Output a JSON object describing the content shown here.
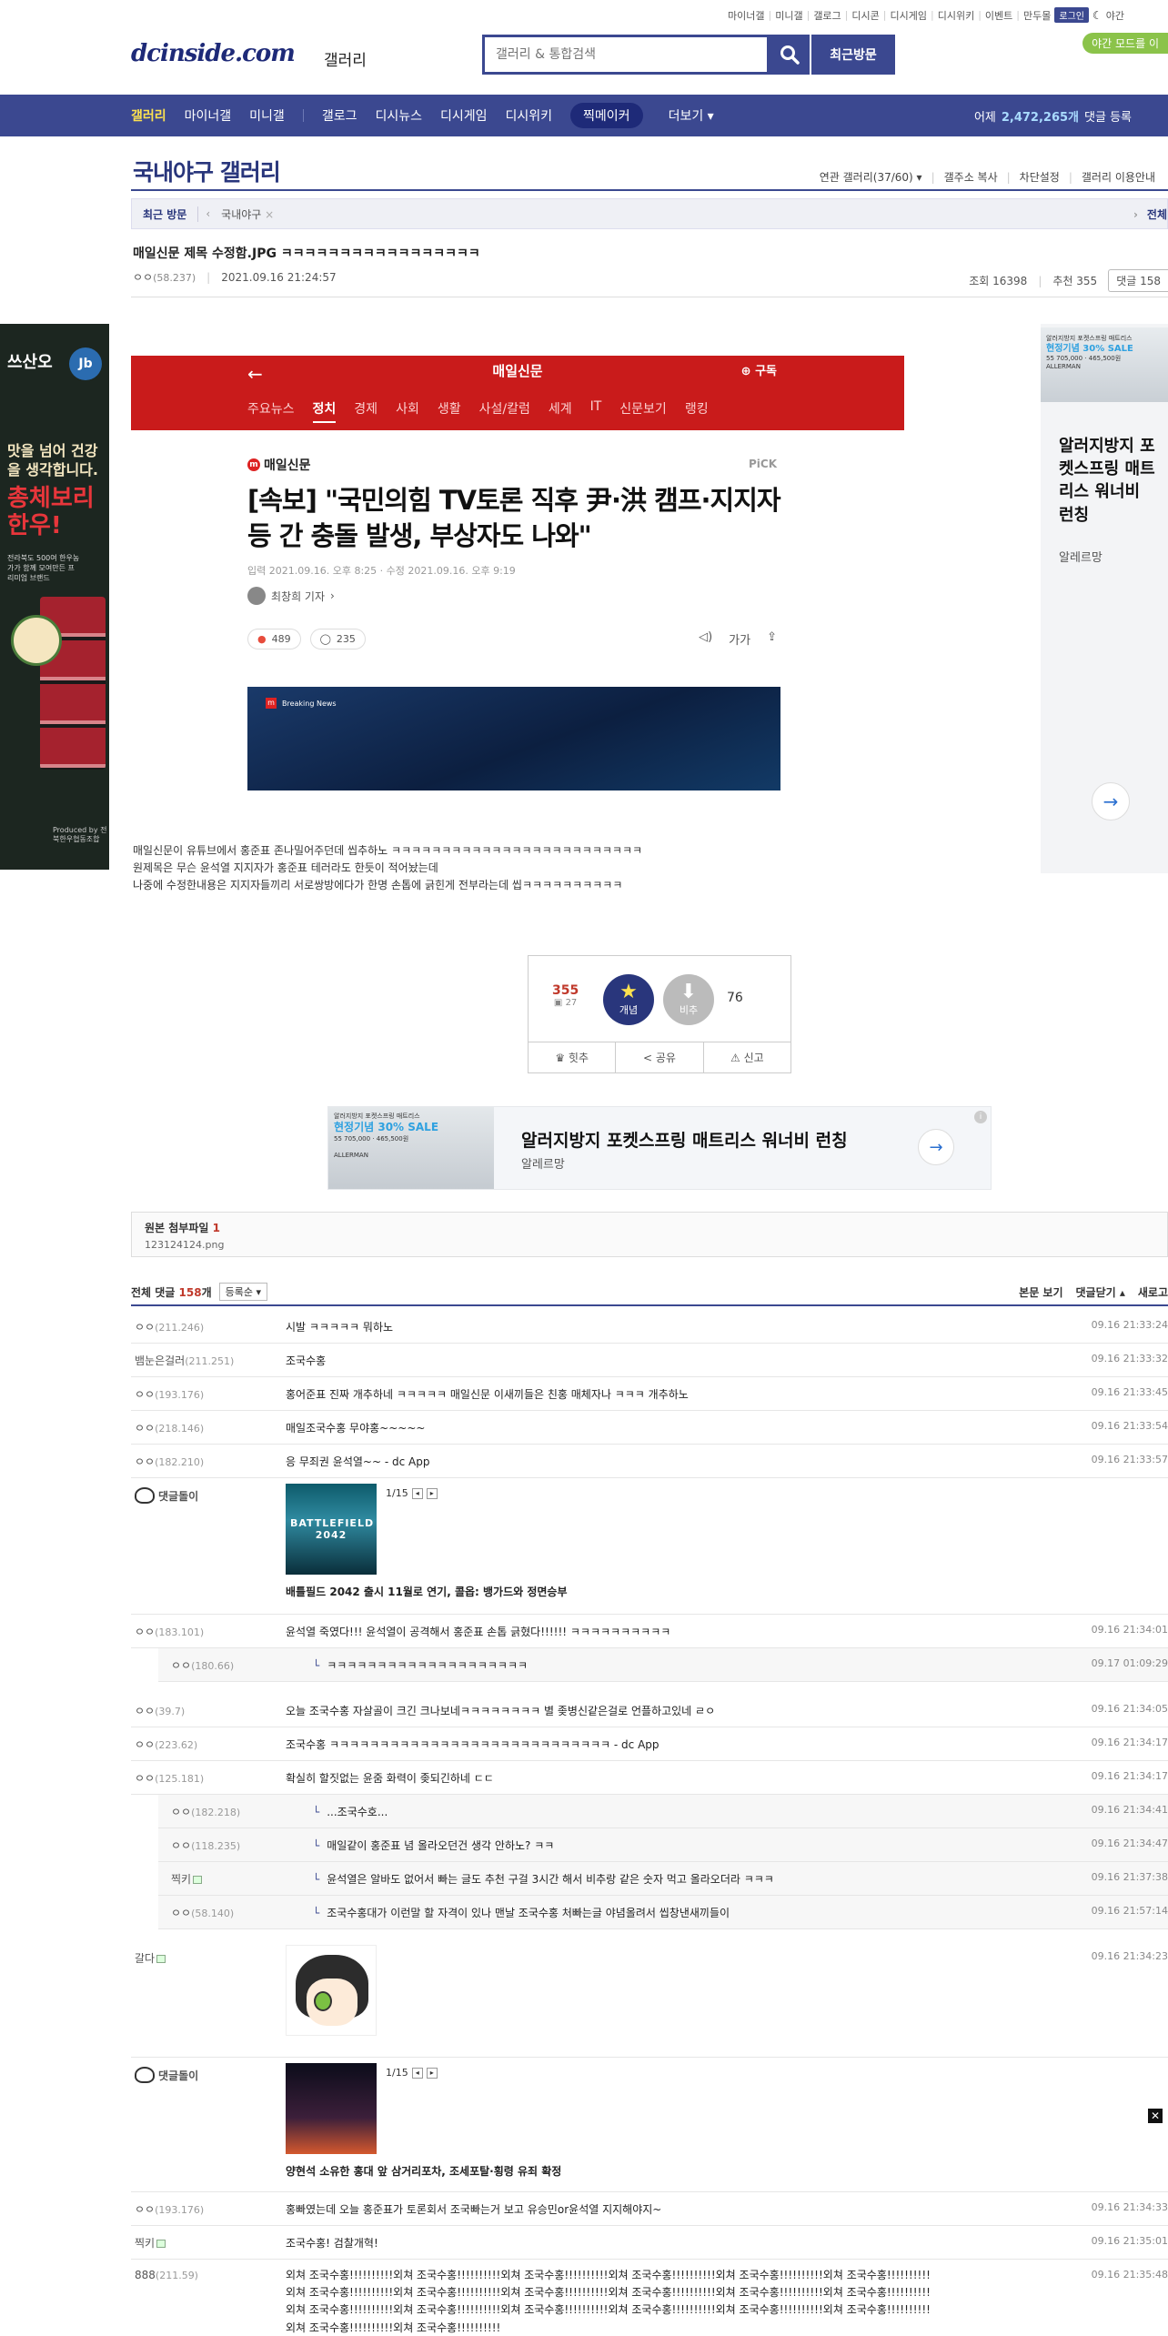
{
  "top_links": [
    "마이너갤",
    "미니갤",
    "갤로그",
    "디시콘",
    "디시게임",
    "디시위키",
    "이벤트",
    "만두몰"
  ],
  "login_label": "로그인",
  "night_short": "야간",
  "night_mode_btn": "야간 모드를 이",
  "logo": "dcinside.com",
  "logo_sub": "갤러리",
  "search": {
    "placeholder": "갤러리 & 통합검색"
  },
  "recent_visit_btn": "최근방문",
  "nav": {
    "items": [
      "갤러리",
      "마이너갤",
      "미니갤",
      "갤로그",
      "디시뉴스",
      "디시게임",
      "디시위키",
      "찍메이커",
      "더보기"
    ],
    "stats_prefix": "어제",
    "stats_num": "2,472,265개",
    "stats_suffix": "댓글 등록"
  },
  "gallery": {
    "title": "국내야구 갤러리",
    "links": [
      "연관 갤러리(37/60)",
      "갤주소 복사",
      "차단설정",
      "갤러리 이용안내"
    ],
    "recent_label": "최근 방문",
    "recent_tag": "국내야구",
    "recent_more": "전체"
  },
  "post": {
    "title": "매일신문 제목 수정함.JPG ㅋㅋㅋㅋㅋㅋㅋㅋㅋㅋㅋㅋㅋㅋㅋㅋㅋ",
    "author": "ㅇㅇ",
    "author_ip": "(58.237)",
    "date": "2021.09.16 21:24:57",
    "views": "조회 16398",
    "recommends": "추천 355",
    "comments": "댓글 158",
    "body": [
      "매일신문이 유튜브에서 홍준표 존나밀어주던데 씹추하노 ㅋㅋㅋㅋㅋㅋㅋㅋㅋㅋㅋㅋㅋㅋㅋㅋㅋㅋㅋㅋㅋㅋㅋㅋㅋ",
      "원제목은 무슨 윤석열 지지자가 홍준표 테러라도 한듯이 적어놨는데",
      "나중에 수정한내용은 지지자들끼리 서로쌍방에다가 한명 손톱에 긁힌게 전부라는데 씹ㅋㅋㅋㅋㅋㅋㅋㅋㅋㅋ"
    ]
  },
  "news": {
    "press_name": "매일신문",
    "subscribe": "구독",
    "tabs": [
      "주요뉴스",
      "정치",
      "경제",
      "사회",
      "생활",
      "사설/칼럼",
      "세계",
      "IT",
      "신문보기",
      "랭킹"
    ],
    "pick": "PiCK",
    "headline": "[속보] \"국민의힘 TV토론 직후 尹·洪 캠프·지지자 등 간 충돌 발생, 부상자도 나와\"",
    "date": "입력 2021.09.16. 오후 8:25 · 수정 2021.09.16. 오후 9:19",
    "reporter": "최창희 기자",
    "reactions": "489",
    "comment_count": "235",
    "font_btn": "가가",
    "image_label": "Breaking News"
  },
  "left_ad": {
    "brand": "쓰산오",
    "badge": "Jb",
    "tagline": "맛을 넘어 건강을 생각합니다.",
    "product": "총체보리 한우!",
    "desc": "전라북도 500여 한우농가가 함께 모여만든 프리미엄 브랜드",
    "producer": "Produced by 전북한우협동조합"
  },
  "right_ad": {
    "small": "알러지방지 포켓스프링 매트리스",
    "sale": "현정기념 30% SALE",
    "price": "55 705,000 · 465,500원",
    "brand_mark": "ALLERMAN",
    "title": "알러지방지 포켓스프링 매트리스 워너비 런칭",
    "by": "알레르망"
  },
  "recommend": {
    "up": "355",
    "fixed": "27",
    "up_label": "개념",
    "down_label": "비추",
    "down": "76",
    "hit": "힛추",
    "share": "공유",
    "report": "신고"
  },
  "mid_ad": {
    "title": "알러지방지 포켓스프링 매트리스 워너비 런칭",
    "by": "알레르망"
  },
  "attach": {
    "label": "원본 첨부파일",
    "count": "1",
    "file": "123124124.png"
  },
  "comment_head": {
    "label": "전체 댓글",
    "count": "158",
    "unit": "개",
    "sort": "등록순",
    "view_body": "본문 보기",
    "close": "댓글닫기",
    "refresh": "새로고"
  },
  "comments": [
    {
      "nick": "ㅇㅇ",
      "ip": "(211.246)",
      "text": "시발 ㅋㅋㅋㅋㅋ 뭐하노",
      "time": "09.16 21:33:24"
    },
    {
      "nick": "뱀눈은걸러",
      "ip": "(211.251)",
      "text": "조국수홍",
      "time": "09.16 21:33:32"
    },
    {
      "nick": "ㅇㅇ",
      "ip": "(193.176)",
      "text": "홍어준표 진짜 개추하네 ㅋㅋㅋㅋㅋ 매일신문 이새끼들은 친홍 매체자나 ㅋㅋㅋ 개추하노",
      "time": "09.16 21:33:45"
    },
    {
      "nick": "ㅇㅇ",
      "ip": "(218.146)",
      "text": "매일조국수홍 무야홍~~~~~",
      "time": "09.16 21:33:54"
    },
    {
      "nick": "ㅇㅇ",
      "ip": "(182.210)",
      "text": "응 무죄권 윤석열~~ - dc App",
      "time": "09.16 21:33:57"
    },
    {
      "nick": "댓글돌이",
      "text": "",
      "page": "1/15",
      "caption": "배틀필드 2042 출시 11월로 연기, 콜옵: 뱅가드와 정면승부",
      "thumb": "BATTLEFIELD 2042"
    },
    {
      "nick": "ㅇㅇ",
      "ip": "(183.101)",
      "text": "윤석열 죽였다!!! 윤석열이 공격해서 홍준표 손톱 긁혔다!!!!!! ㅋㅋㅋㅋㅋㅋㅋㅋㅋㅋ",
      "time": "09.16 21:34:01"
    },
    {
      "nick": "ㅇㅇ",
      "ip": "(180.66)",
      "text": "ㅋㅋㅋㅋㅋㅋㅋㅋㅋㅋㅋㅋㅋㅋㅋㅋㅋㅋㅋㅋ",
      "time": "09.17 01:09:29"
    },
    {
      "nick": "ㅇㅇ",
      "ip": "(39.7)",
      "text": "오늘 조국수홍 자살골이 크긴 크나보네ㅋㅋㅋㅋㅋㅋㅋㅋ 별 좆병신같은걸로 언플하고있네 ㄹㅇ",
      "time": "09.16 21:34:05"
    },
    {
      "nick": "ㅇㅇ",
      "ip": "(223.62)",
      "text": "조국수홍 ㅋㅋㅋㅋㅋㅋㅋㅋㅋㅋㅋㅋㅋㅋㅋㅋㅋㅋㅋㅋㅋㅋㅋㅋㅋㅋㅋㅋ - dc App",
      "time": "09.16 21:34:17"
    },
    {
      "nick": "ㅇㅇ",
      "ip": "(125.181)",
      "text": "확실히 할짓없는 윤줌 화력이 좆되긴하네 ㄷㄷ",
      "time": "09.16 21:34:17"
    },
    {
      "nick": "ㅇㅇ",
      "ip": "(182.218)",
      "text": "...조국수호...",
      "time": "09.16 21:34:41"
    },
    {
      "nick": "ㅇㅇ",
      "ip": "(118.235)",
      "text": "매일같이 홍준표 념 올라오던건 생각 안하노? ㅋㅋ",
      "time": "09.16 21:34:47"
    },
    {
      "nick": "찍키",
      "ip": "",
      "text": "윤석열은 알바도 없어서 빠는 글도 추천 구걸 3시간 해서 비추랑 같은 숫자 먹고 올라오더라 ㅋㅋㅋ",
      "time": "09.16 21:37:38"
    },
    {
      "nick": "ㅇㅇ",
      "ip": "(58.140)",
      "text": "조국수홍대가 이런말 할 자격이 있나 맨날 조국수홍 처빠는글 야념올려서 씹창낸새끼들이",
      "time": "09.16 21:57:14"
    },
    {
      "nick": "갈다",
      "ip": "",
      "text": "",
      "time": "09.16 21:34:23"
    },
    {
      "nick": "댓글돌이",
      "text": "",
      "page": "1/15",
      "caption": "양현석 소유한 홍대 앞 삼거리포차, 조세포탈·횡령 유죄 확정"
    },
    {
      "nick": "ㅇㅇ",
      "ip": "(193.176)",
      "text": "홍빠였는데 오늘 홍준표가 토론회서 조국빠는거 보고 유승민or윤석열 지지해야지~",
      "time": "09.16 21:34:33"
    },
    {
      "nick": "찍키",
      "ip": "",
      "text": "조국수홍! 검찰개혁!",
      "time": "09.16 21:35:01"
    },
    {
      "nick": "888",
      "ip": "(211.59)",
      "text": "외쳐 조국수홍!!!!!!!!!!외쳐 조국수홍!!!!!!!!!!외쳐 조국수홍!!!!!!!!!!외쳐 조국수홍!!!!!!!!!!외쳐 조국수홍!!!!!!!!!!외쳐 조국수홍!!!!!!!!!!",
      "text2": "외쳐 조국수홍!!!!!!!!!!외쳐 조국수홍!!!!!!!!!!외쳐 조국수홍!!!!!!!!!!외쳐 조국수홍!!!!!!!!!!외쳐 조국수홍!!!!!!!!!!외쳐 조국수홍!!!!!!!!!!",
      "text3": "외쳐 조국수홍!!!!!!!!!!외쳐 조국수홍!!!!!!!!!!외쳐 조국수홍!!!!!!!!!!외쳐 조국수홍!!!!!!!!!!외쳐 조국수홍!!!!!!!!!!외쳐 조국수홍!!!!!!!!!!",
      "text4": "외쳐 조국수홍!!!!!!!!!!외쳐 조국수홍!!!!!!!!!!",
      "time": "09.16 21:35:48"
    }
  ]
}
